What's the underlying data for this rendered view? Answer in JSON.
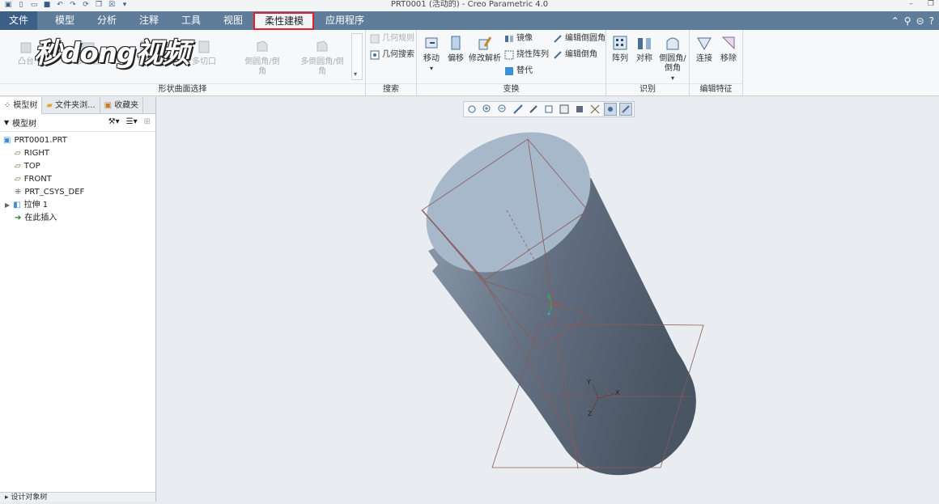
{
  "window": {
    "title": "PRT0001 (活动的) - Creo Parametric 4.0"
  },
  "menu": {
    "file": "文件",
    "items": [
      "模型",
      "分析",
      "注释",
      "工具",
      "视图",
      "柔性建模",
      "应用程序"
    ],
    "active_index": 5
  },
  "ribbon": {
    "shape_group": {
      "label": "形状曲面选择",
      "buttons": [
        "凸台",
        "多凸台",
        "切口",
        "多切口",
        "倒圆角/倒角",
        "多倒圆角/倒角"
      ]
    },
    "search_group": {
      "label": "搜索",
      "buttons": [
        "几何规则",
        "几何搜索"
      ]
    },
    "transform_group": {
      "label": "变换",
      "buttons": [
        "移动",
        "偏移",
        "修改解析"
      ],
      "small_buttons": [
        "镜像",
        "挠性阵列",
        "替代",
        "编辑倒圆角",
        "编辑倒角"
      ]
    },
    "recognize_group": {
      "label": "识别",
      "buttons": [
        "阵列",
        "对称",
        "倒圆角/倒角"
      ]
    },
    "edit_group": {
      "label": "编辑特征",
      "buttons": [
        "连接",
        "移除"
      ]
    }
  },
  "watermark": "秒dong视频",
  "left_panel": {
    "tabs": [
      "模型树",
      "文件夹浏...",
      "收藏夹"
    ],
    "tree_title": "模型树",
    "items": [
      {
        "label": "PRT0001.PRT",
        "icon": "part-icon"
      },
      {
        "label": "RIGHT",
        "icon": "plane-icon"
      },
      {
        "label": "TOP",
        "icon": "plane-icon"
      },
      {
        "label": "FRONT",
        "icon": "plane-icon"
      },
      {
        "label": "PRT_CSYS_DEF",
        "icon": "csys-icon"
      },
      {
        "label": "拉伸 1",
        "icon": "extrude-icon"
      },
      {
        "label": "在此插入",
        "icon": "insert-arrow-icon"
      }
    ],
    "footer": "设计对象树"
  },
  "csys_labels": {
    "x": "X",
    "y": "Y",
    "z": "Z"
  },
  "colors": {
    "menubar": "#5f7d9a",
    "file_menu": "#3b5f86",
    "highlight": "#e0202a",
    "cylinder_top": "#a8b8cb",
    "cylinder_side": "#5c6b7c"
  }
}
